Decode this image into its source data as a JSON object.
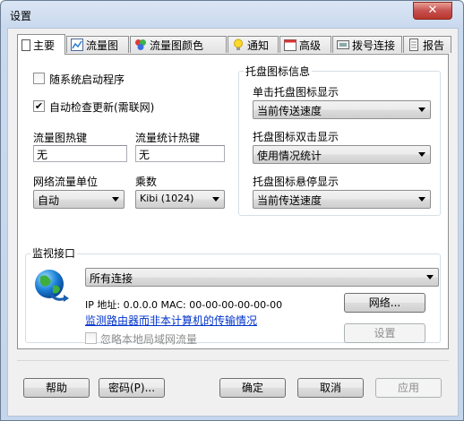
{
  "window": {
    "title": "设置",
    "close_glyph": "✕"
  },
  "tabs": [
    {
      "label": "主要",
      "icon": "page-icon"
    },
    {
      "label": "流量图",
      "icon": "chart-icon"
    },
    {
      "label": "流量图颜色",
      "icon": "palette-icon"
    },
    {
      "label": "通知",
      "icon": "bulb-icon"
    },
    {
      "label": "高级",
      "icon": "calendar-icon"
    },
    {
      "label": "拨号连接",
      "icon": "dialup-icon"
    },
    {
      "label": "报告",
      "icon": "report-icon"
    }
  ],
  "main": {
    "autostart": {
      "label": "随系统启动程序",
      "checked": false
    },
    "autoupdate": {
      "label": "自动检查更新(需联网)",
      "checked": true
    },
    "graph_hotkey": {
      "label": "流量图热键",
      "value": "无"
    },
    "stats_hotkey": {
      "label": "流量统计热键",
      "value": "无"
    },
    "unit": {
      "label": "网络流量单位",
      "value": "自动"
    },
    "multiplier": {
      "label": "乘数",
      "value": "Kibi (1024)"
    },
    "tray": {
      "title": "托盘图标信息",
      "single_click": {
        "label": "单击托盘图标显示",
        "value": "当前传送速度"
      },
      "double_click": {
        "label": "托盘图标双击显示",
        "value": "使用情况统计"
      },
      "hover": {
        "label": "托盘图标悬停显示",
        "value": "当前传送速度"
      }
    },
    "monitor": {
      "title": "监视接口",
      "interface": "所有连接",
      "ip_info": "IP 地址: 0.0.0.0    MAC: 00-00-00-00-00-00",
      "router_link": "监测路由器而非本计算机的传输情况",
      "ignore_lan": {
        "label": "忽略本地局域网流量",
        "checked": false
      },
      "network_button": "网络...",
      "settings_button": "设置"
    }
  },
  "footer": {
    "help": "帮助",
    "password": "密码(P)...",
    "ok": "确定",
    "cancel": "取消",
    "apply": "应用"
  },
  "check_glyph": "✔"
}
